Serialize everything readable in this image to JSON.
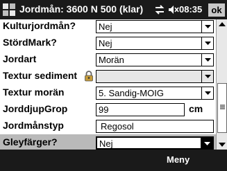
{
  "titlebar": {
    "title": "Jordmån: 3600 N 500 (klar)",
    "time": "08:35",
    "ok": "ok"
  },
  "fields": [
    {
      "label": "Kulturjordmån?",
      "value": "Nej"
    },
    {
      "label": "StördMark?",
      "value": "Nej"
    },
    {
      "label": "Jordart",
      "value": "Morän"
    },
    {
      "label": "Textur sediment",
      "value": ""
    },
    {
      "label": "Textur morän",
      "value": "5. Sandig-MOIG"
    },
    {
      "label": "JorddjupGrop",
      "value": "99",
      "unit": "cm"
    },
    {
      "label": "Jordmånstyp",
      "value": "Regosol"
    },
    {
      "label": "Gleyfärger?",
      "value": "Nej"
    }
  ],
  "menubar": {
    "right_label": "Meny"
  },
  "icons": {
    "logo": "windows-flag-icon",
    "connectivity": "connectivity-arrows-icon",
    "volume": "speaker-muted-icon",
    "lock": "lock-icon"
  }
}
